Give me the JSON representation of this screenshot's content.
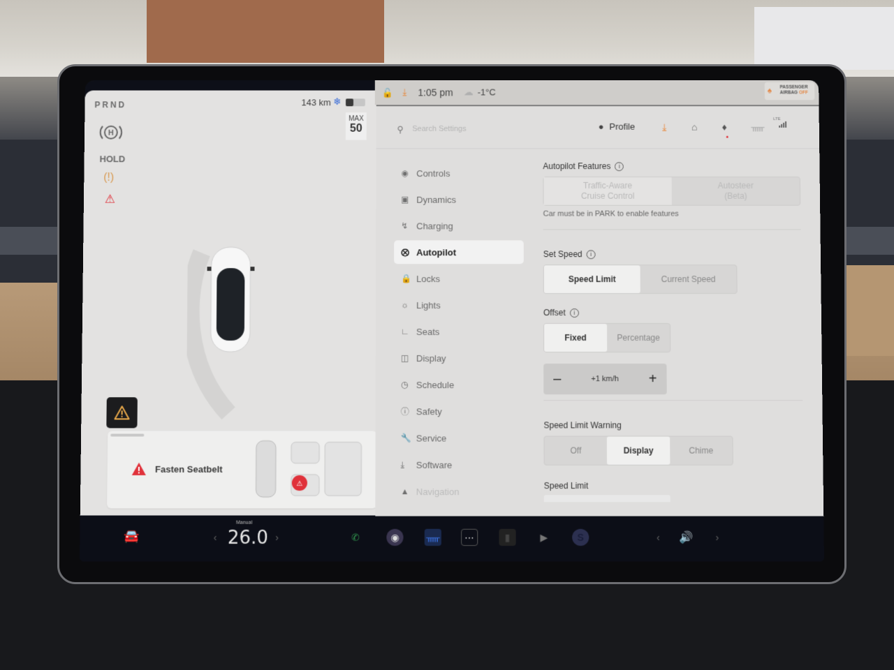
{
  "left_panel": {
    "gear_selector": "PRND",
    "hold_label": "HOLD",
    "range": "143 km",
    "speed_max_label": "MAX",
    "speed_max_value": "50",
    "battery_level_fraction": 0.4,
    "alert_message": "Fasten Seatbelt"
  },
  "status_bar": {
    "time": "1:05 pm",
    "temperature": "-1°C",
    "airbag_line1": "PASSENGER",
    "airbag_line2": "AIRBAG",
    "airbag_status": "OFF"
  },
  "settings": {
    "search_placeholder": "Search Settings",
    "profile_label": "Profile",
    "lte_label": "LTE",
    "nav": [
      {
        "label": "Controls",
        "icon": "toggle-icon"
      },
      {
        "label": "Dynamics",
        "icon": "car-icon"
      },
      {
        "label": "Charging",
        "icon": "bolt-icon"
      },
      {
        "label": "Autopilot",
        "icon": "steering-wheel-icon",
        "active": true
      },
      {
        "label": "Locks",
        "icon": "lock-icon"
      },
      {
        "label": "Lights",
        "icon": "sun-icon"
      },
      {
        "label": "Seats",
        "icon": "seat-icon"
      },
      {
        "label": "Display",
        "icon": "display-icon"
      },
      {
        "label": "Schedule",
        "icon": "alarm-icon"
      },
      {
        "label": "Safety",
        "icon": "alert-circle-icon"
      },
      {
        "label": "Service",
        "icon": "wrench-icon"
      },
      {
        "label": "Software",
        "icon": "download-icon"
      },
      {
        "label": "Navigation",
        "icon": "navigation-icon"
      }
    ],
    "autopilot_features": {
      "title": "Autopilot Features",
      "options": [
        "Traffic-Aware Cruise Control",
        "Autosteer (Beta)"
      ],
      "option1_line1": "Traffic-Aware",
      "option1_line2": "Cruise Control",
      "option2_line1": "Autosteer",
      "option2_line2": "(Beta)",
      "note": "Car must be in PARK to enable features"
    },
    "set_speed": {
      "title": "Set Speed",
      "options": [
        "Speed Limit",
        "Current Speed"
      ],
      "selected": "Speed Limit"
    },
    "offset": {
      "title": "Offset",
      "options": [
        "Fixed",
        "Percentage"
      ],
      "selected": "Fixed",
      "value": "+1 km/h",
      "minus": "–",
      "plus": "+"
    },
    "speed_limit_warning": {
      "title": "Speed Limit Warning",
      "options": [
        "Off",
        "Display",
        "Chime"
      ],
      "selected": "Display"
    },
    "speed_limit": {
      "title": "Speed Limit"
    }
  },
  "taskbar": {
    "climate_mode": "Manual",
    "cabin_temperature": "26.0",
    "arrow_left": "‹",
    "arrow_right": "›"
  }
}
